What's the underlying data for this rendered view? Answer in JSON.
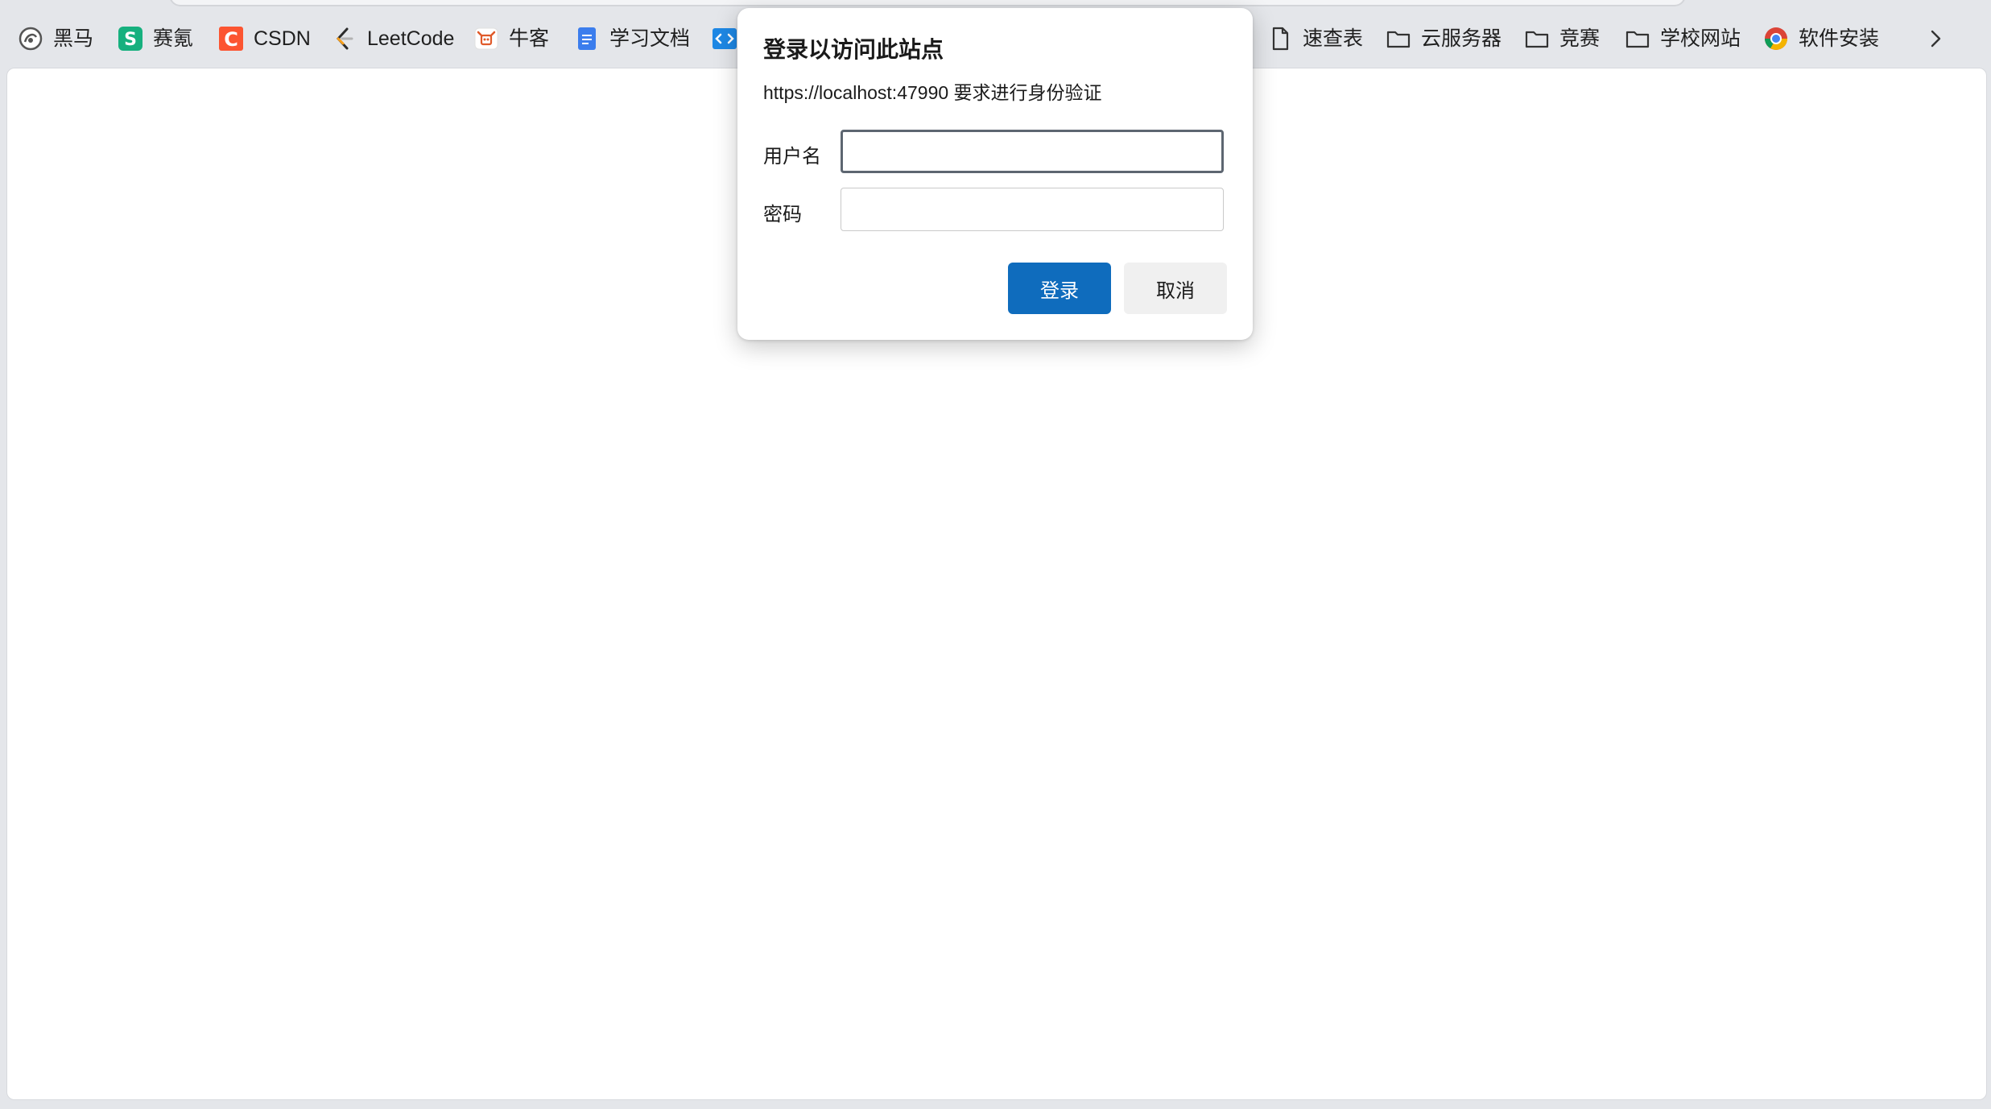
{
  "bookmarks": [
    {
      "label": "黑马",
      "icon": "heima-logo-icon"
    },
    {
      "label": "赛氪",
      "icon": "saike-logo-icon"
    },
    {
      "label": "CSDN",
      "icon": "csdn-logo-icon"
    },
    {
      "label": "LeetCode",
      "icon": "leetcode-logo-icon"
    },
    {
      "label": "牛客",
      "icon": "nowcoder-logo-icon"
    },
    {
      "label": "学习文档",
      "icon": "document-icon"
    },
    {
      "label": "",
      "icon": "code-icon"
    },
    {
      "label": "速查表",
      "icon": "file-icon"
    },
    {
      "label": "云服务器",
      "icon": "folder-icon"
    },
    {
      "label": "竞赛",
      "icon": "folder-icon"
    },
    {
      "label": "学校网站",
      "icon": "folder-icon"
    },
    {
      "label": "软件安装",
      "icon": "chrome-logo-icon"
    }
  ],
  "dialog": {
    "title": "登录以访问此站点",
    "subtitle": "https://localhost:47990 要求进行身份验证",
    "username_label": "用户名",
    "username_value": "",
    "password_label": "密码",
    "password_value": "",
    "login_button": "登录",
    "cancel_button": "取消"
  },
  "colors": {
    "primary": "#0f6cbd",
    "chrome_bg": "#e4e6ea"
  }
}
